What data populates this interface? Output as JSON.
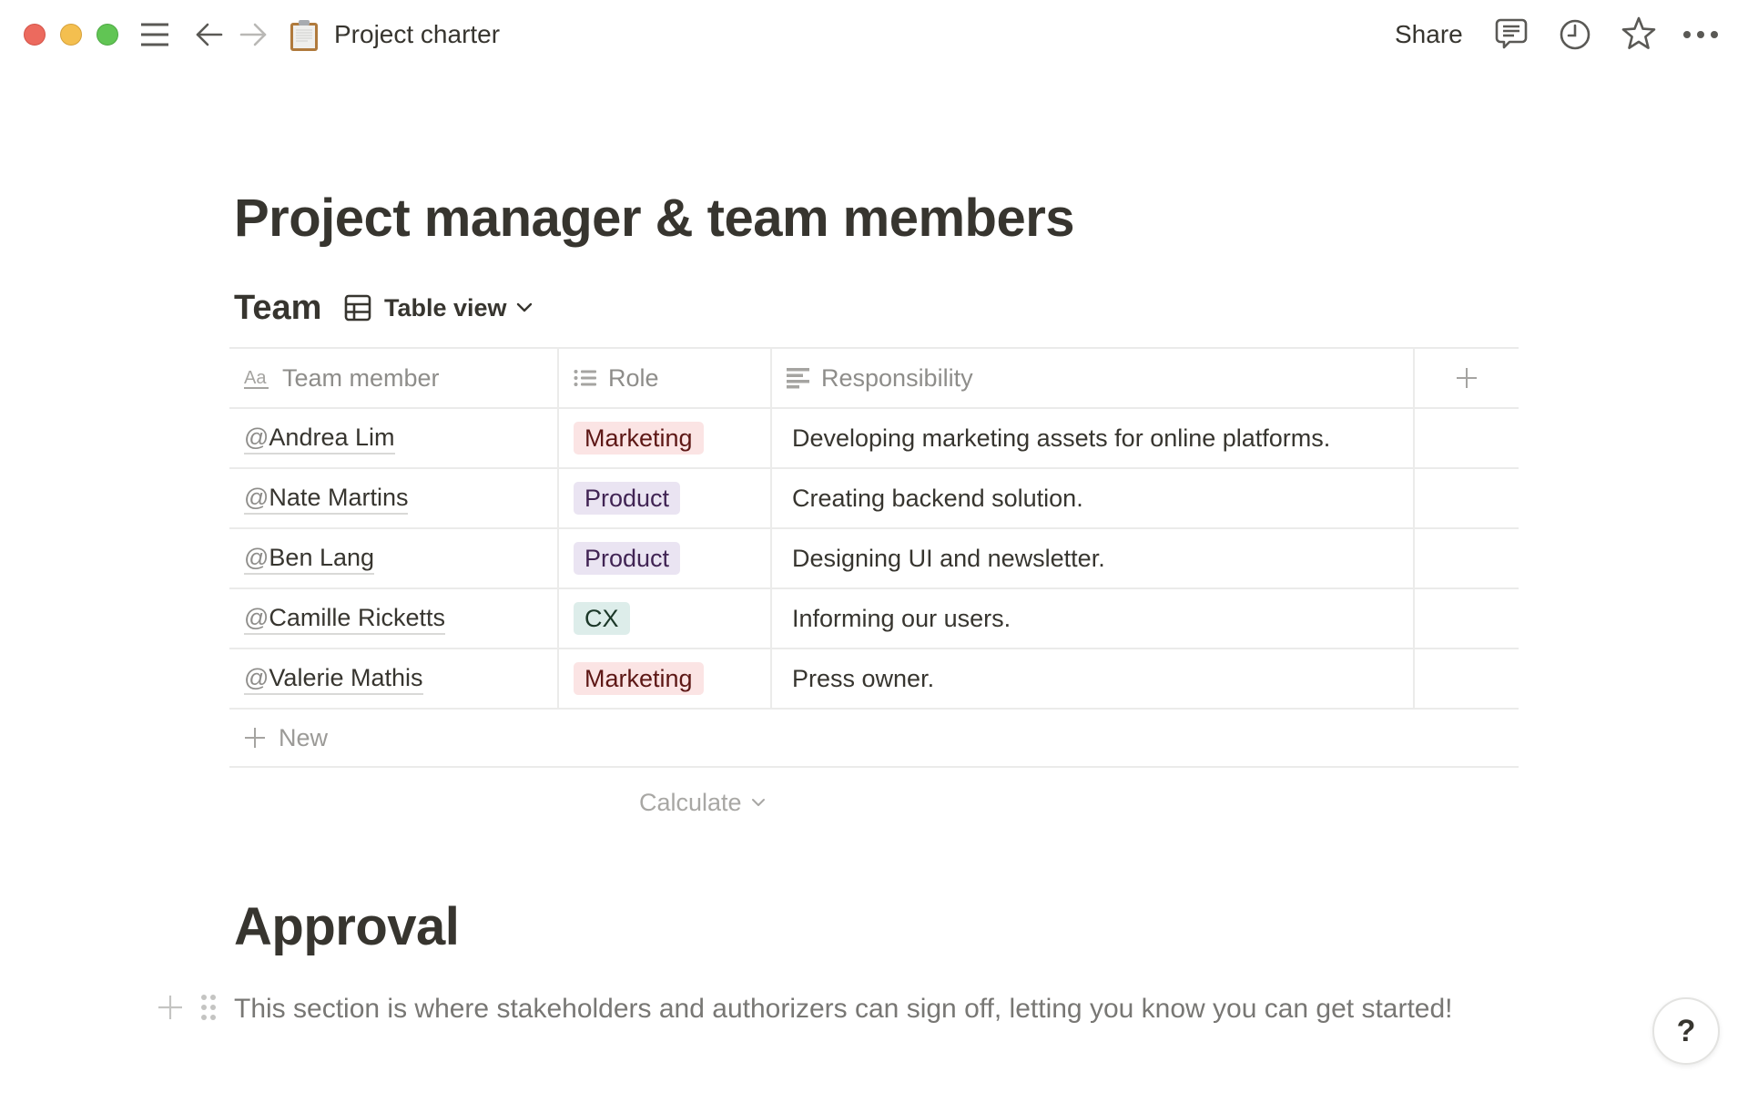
{
  "window": {
    "title": "Project charter",
    "page_icon": "clipboard-icon"
  },
  "topbar": {
    "left_icons": [
      "close-window",
      "minimize-window",
      "maximize-window",
      "menu-icon",
      "back-arrow-icon",
      "forward-arrow-icon"
    ],
    "share_label": "Share",
    "right_icons": [
      "comment-icon",
      "history-clock-icon",
      "favorite-star-icon",
      "more-dots-icon"
    ]
  },
  "page": {
    "title": "Project manager & team members"
  },
  "database": {
    "title": "Team",
    "view": {
      "icon": "table-icon",
      "label": "Table view"
    },
    "columns": [
      {
        "icon": "text-property-icon",
        "label": "Team member"
      },
      {
        "icon": "multi-select-list-icon",
        "label": "Role"
      },
      {
        "icon": "text-lines-icon",
        "label": "Responsibility"
      }
    ],
    "add_column_icon": "plus-icon",
    "rows": [
      {
        "member": "Andrea Lim",
        "role": "Marketing",
        "responsibility": "Developing marketing assets for online platforms."
      },
      {
        "member": "Nate Martins",
        "role": "Product",
        "responsibility": "Creating backend solution."
      },
      {
        "member": "Ben Lang",
        "role": "Product",
        "responsibility": "Designing UI and newsletter."
      },
      {
        "member": "Camille Ricketts",
        "role": "CX",
        "responsibility": "Informing our users."
      },
      {
        "member": "Valerie Mathis",
        "role": "Marketing",
        "responsibility": "Press owner."
      }
    ],
    "mention_prefix": "@",
    "role_colors": {
      "Marketing": {
        "bg": "#fbe4e4",
        "fg": "#5d1715"
      },
      "Product": {
        "bg": "#eae4f2",
        "fg": "#412454"
      },
      "CX": {
        "bg": "#ddedea",
        "fg": "#1c3829"
      }
    },
    "new_row_label": "New",
    "calculate_label": "Calculate"
  },
  "approval": {
    "title": "Approval",
    "text": "This section is where stakeholders and authorizers can sign off, letting you know you can get started!"
  },
  "help_button": {
    "label": "?"
  }
}
